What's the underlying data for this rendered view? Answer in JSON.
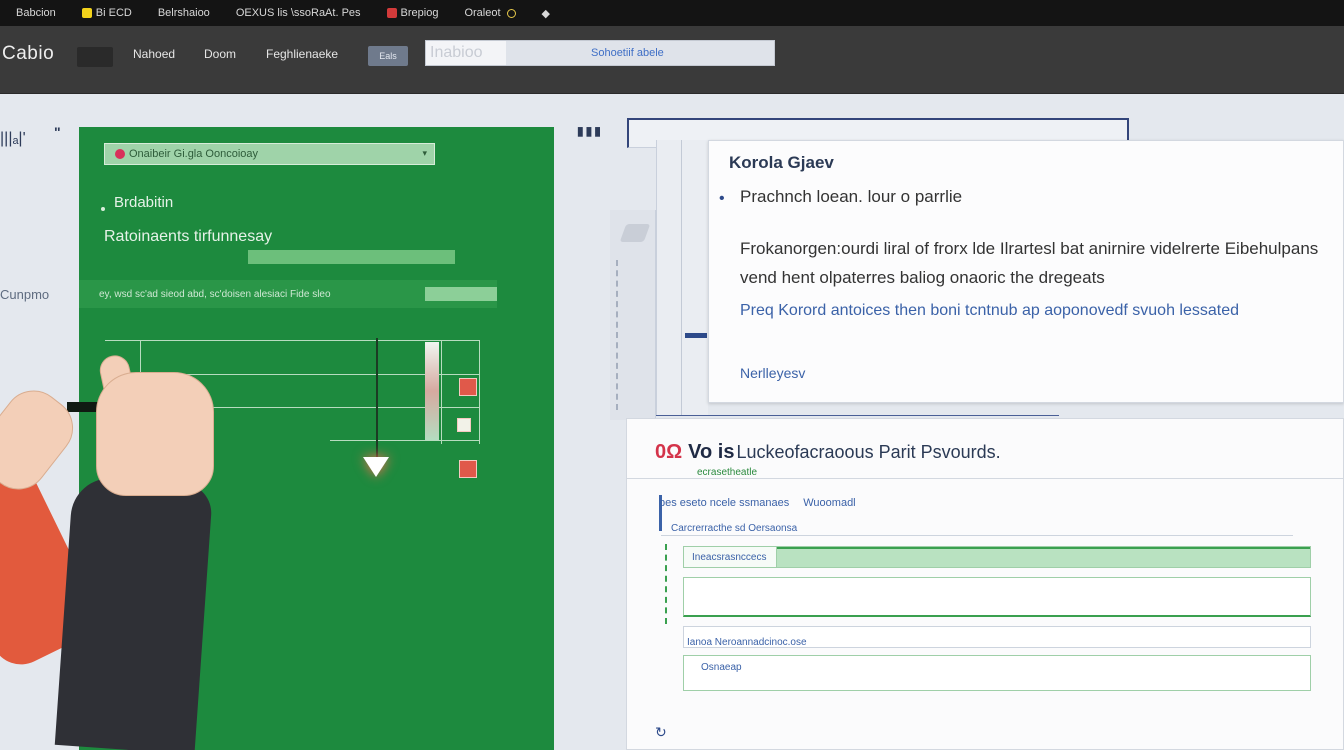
{
  "bookmarks": [
    {
      "label": "Babcion",
      "color": ""
    },
    {
      "label": "Bi ECD",
      "color": "#f2d21b"
    },
    {
      "label": "Belrshaioo",
      "color": ""
    },
    {
      "label": "OEXUS lis \\ssoRaAt. Pes",
      "color": ""
    },
    {
      "label": "Brepiog",
      "color": "#d23a3a"
    },
    {
      "label": "Oraleot",
      "color": ""
    },
    {
      "label": "◆",
      "color": ""
    }
  ],
  "toolbar": {
    "logo": "Cabio",
    "items": [
      "Nahoed",
      "Doom",
      "Feghlienaeke"
    ],
    "button": "Eals",
    "search_placeholder": "Inabioo",
    "search_hint": "Sohoetiif abele"
  },
  "left": {
    "icon": "|||ₐ|'",
    "quote": "\"",
    "cut_label": "Cunpmo"
  },
  "green_panel": {
    "select_value": "Onaibeir Gi.gla Ooncoioay",
    "title": "Brdabitin",
    "subtitle": "Ratoinaents tirfunnesay",
    "row_text": "ey, wsd sc'ad sieod abd, sc'doisen alesiaci Fide sleo"
  },
  "card": {
    "heading": "Korola Gjaev",
    "subheading": "Prachnch loean. lour o parrlie",
    "paragraph1": "Frokanorgen:ourdi liral of frorx lde Ilrartesl bat anirnire videlrerte Eibehulpans vend hent olpaterres baliog onaoric the dregeats",
    "paragraph2": "Preq Korord antoices then boni tcntnub ap aoponovedf svuoh lessated",
    "more_link": "Nerlleyesv"
  },
  "form": {
    "prefix": "0Ω",
    "title_bold": "Vo is",
    "title": "Luckeofacraoous Parit Psvourds.",
    "subtitle": "ecrasetheatle",
    "tabs": [
      "bes eseto ncele ssmanaes",
      "Wuoomadl"
    ],
    "label1": "Carcrerracthe sd Oersaonsa",
    "field1_label": "Ineacsrasnccecs",
    "label2": "Ianoa Neroannadcinoc.ose",
    "label3": "Osnaeap"
  }
}
